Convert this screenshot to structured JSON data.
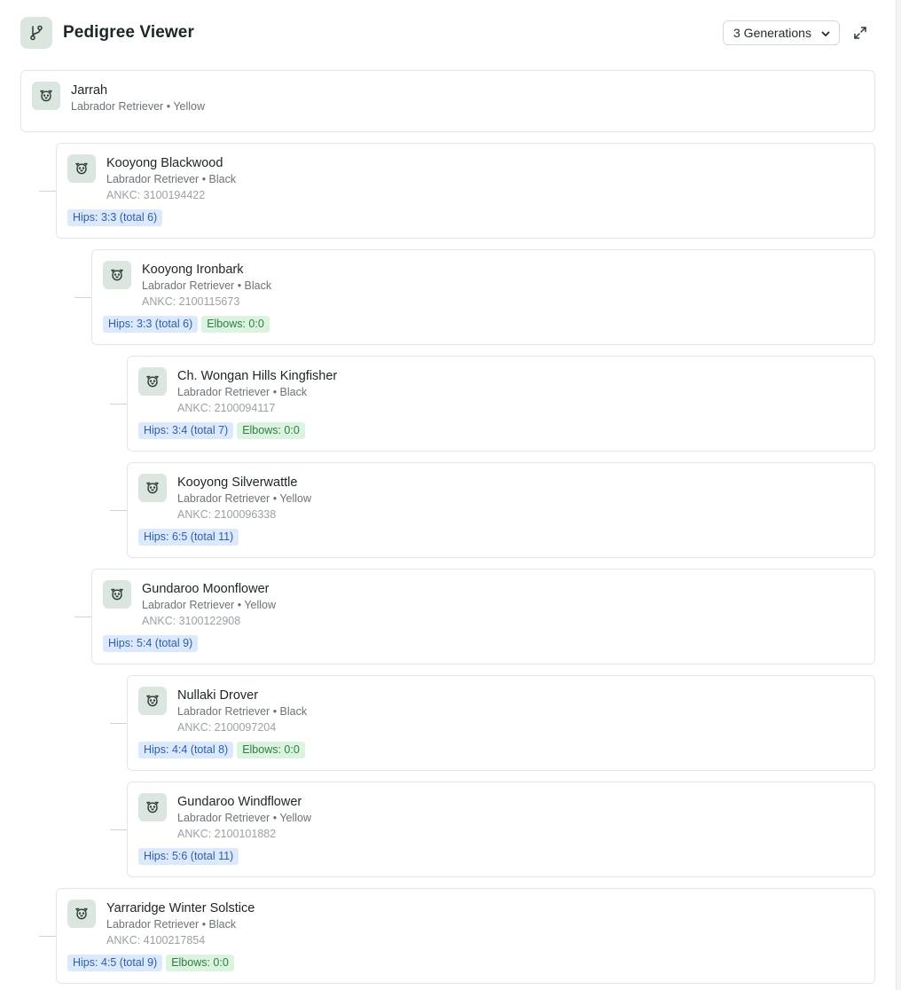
{
  "header": {
    "title": "Pedigree Viewer",
    "generations_selected": "3 Generations",
    "app_icon": "git-branch-icon",
    "expand_icon": "expand-icon"
  },
  "colors": {
    "avatar_bg": "#dbe6df",
    "hips_badge_bg": "#dce8fb",
    "hips_badge_text": "#2f5ea8",
    "elbows_badge_bg": "#dbf3e0",
    "elbows_badge_text": "#2e7d3e"
  },
  "root": {
    "name": "Jarrah",
    "breed": "Labrador Retriever • Yellow"
  },
  "dogs": [
    {
      "name": "Kooyong Blackwood",
      "breed": "Labrador Retriever • Black",
      "reg": "ANKC: 3100194422",
      "hips": "Hips: 3:3 (total 6)",
      "elbows": ""
    },
    {
      "name": "Kooyong Ironbark",
      "breed": "Labrador Retriever • Black",
      "reg": "ANKC: 2100115673",
      "hips": "Hips: 3:3 (total 6)",
      "elbows": "Elbows: 0:0"
    },
    {
      "name": "Ch. Wongan Hills Kingfisher",
      "breed": "Labrador Retriever • Black",
      "reg": "ANKC: 2100094117",
      "hips": "Hips: 3:4 (total 7)",
      "elbows": "Elbows: 0:0"
    },
    {
      "name": "Kooyong Silverwattle",
      "breed": "Labrador Retriever • Yellow",
      "reg": "ANKC: 2100096338",
      "hips": "Hips: 6:5 (total 11)",
      "elbows": ""
    },
    {
      "name": "Gundaroo Moonflower",
      "breed": "Labrador Retriever • Yellow",
      "reg": "ANKC: 3100122908",
      "hips": "Hips: 5:4 (total 9)",
      "elbows": ""
    },
    {
      "name": "Nullaki Drover",
      "breed": "Labrador Retriever • Black",
      "reg": "ANKC: 2100097204",
      "hips": "Hips: 4:4 (total 8)",
      "elbows": "Elbows: 0:0"
    },
    {
      "name": "Gundaroo Windflower",
      "breed": "Labrador Retriever • Yellow",
      "reg": "ANKC: 2100101882",
      "hips": "Hips: 5:6 (total 11)",
      "elbows": ""
    },
    {
      "name": "Yarraridge Winter Solstice",
      "breed": "Labrador Retriever • Black",
      "reg": "ANKC: 4100217854",
      "hips": "Hips: 4:5 (total 9)",
      "elbows": "Elbows: 0:0"
    }
  ]
}
